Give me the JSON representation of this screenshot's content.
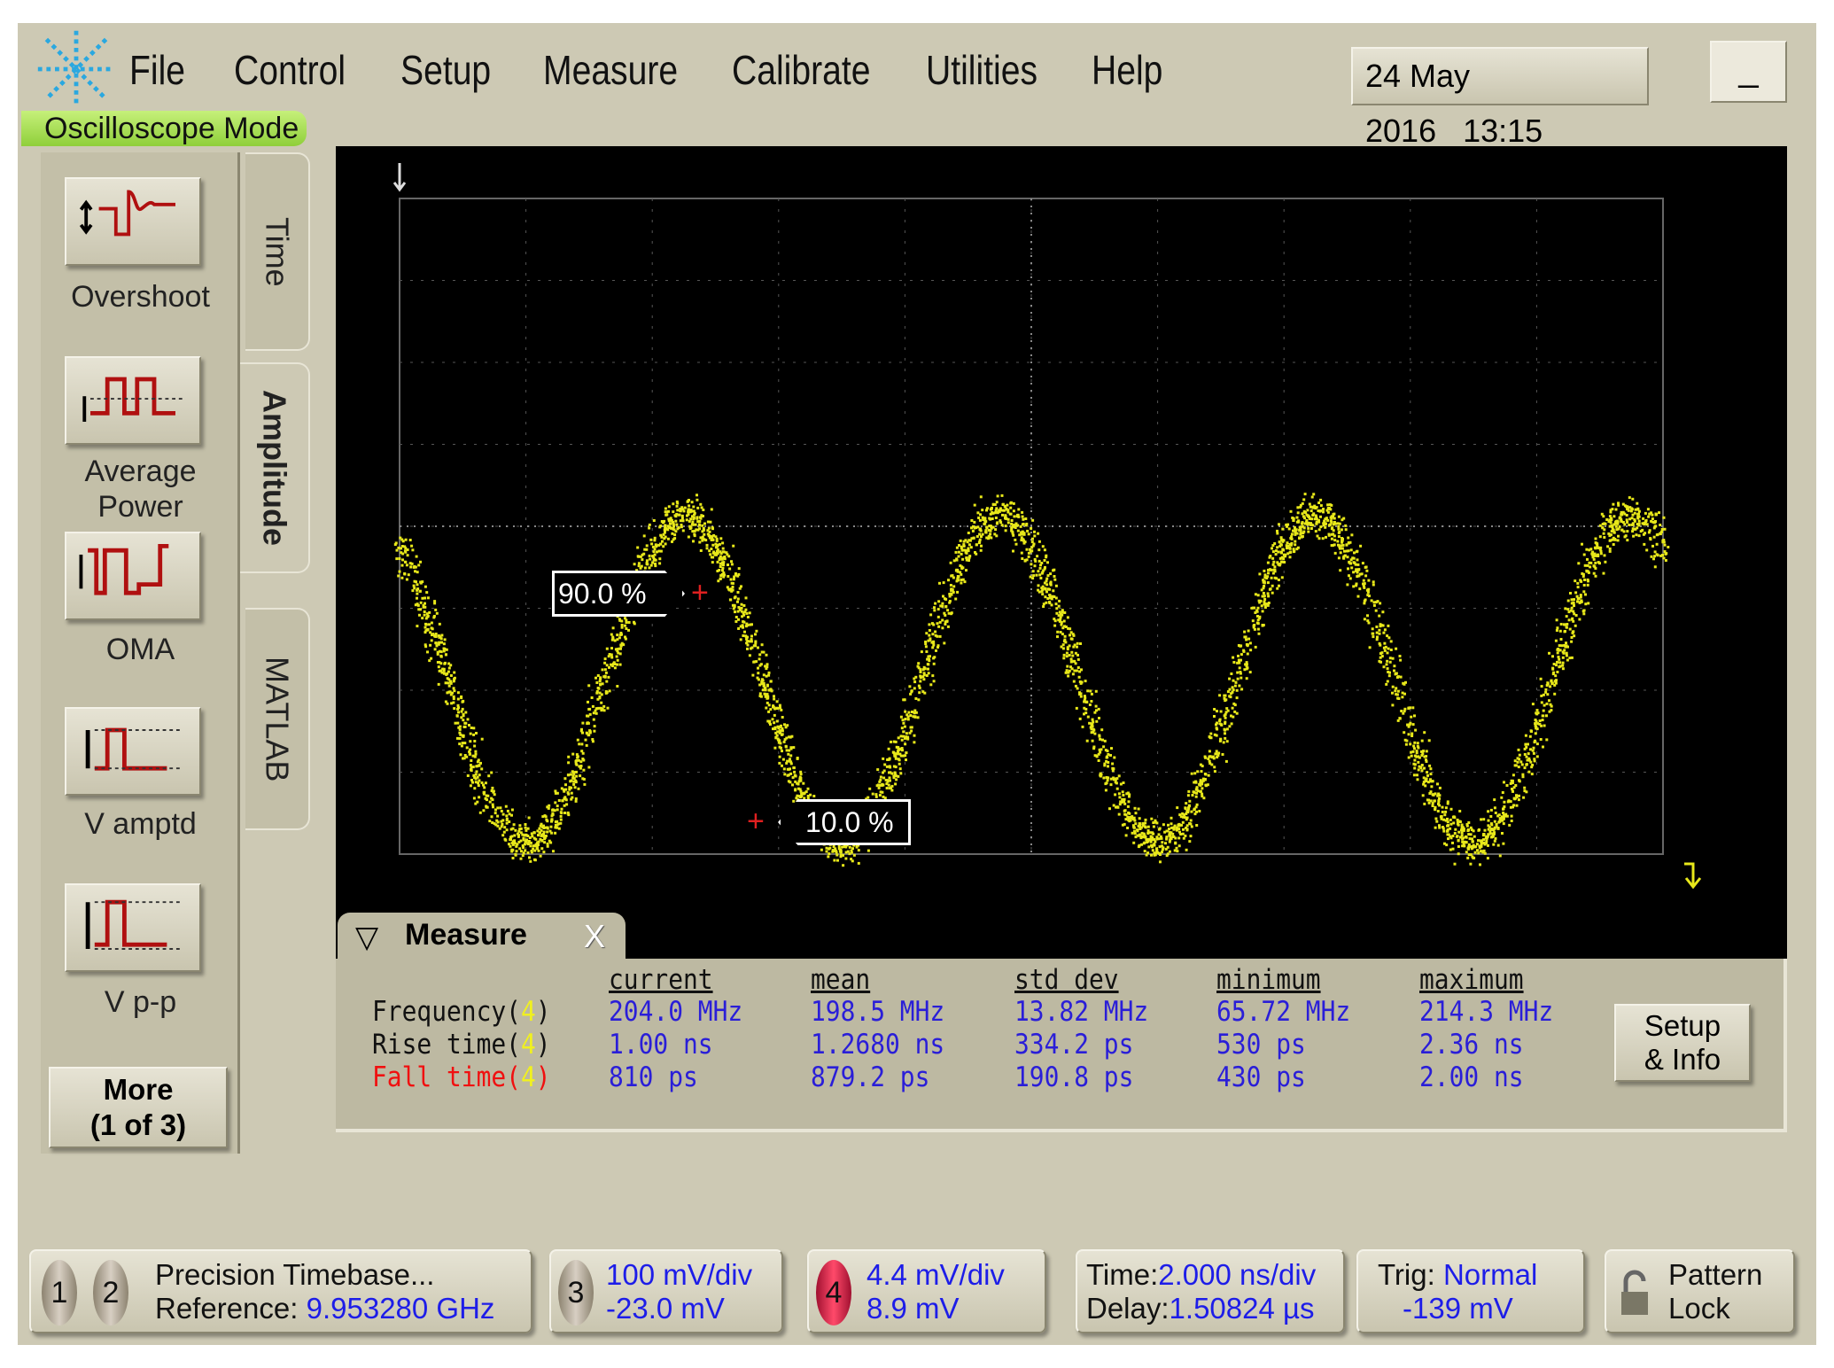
{
  "menu": {
    "items": [
      "File",
      "Control",
      "Setup",
      "Measure",
      "Calibrate",
      "Utilities",
      "Help"
    ],
    "date": "24 May 2016",
    "time": "13:15",
    "minimize_label": "_"
  },
  "mode": "Oscilloscope Mode",
  "sidebar": {
    "buttons": [
      {
        "label": "Overshoot"
      },
      {
        "label": "Average",
        "label2": "Power"
      },
      {
        "label": "OMA"
      },
      {
        "label": "V amptd"
      },
      {
        "label": "V p-p"
      }
    ],
    "more_line1": "More",
    "more_line2": "(1 of 3)"
  },
  "tabs": [
    "Time",
    "Amplitude",
    "MATLAB"
  ],
  "screen": {
    "label_90": "90.0 %",
    "label_10": "10.0 %",
    "trace_color": "#e8e81a"
  },
  "measure": {
    "title": "Measure",
    "close": "X",
    "headers": [
      "current",
      "mean",
      "std dev",
      "minimum",
      "maximum"
    ],
    "rows": [
      {
        "name": "Frequency(",
        "ch": "4",
        "close": ")",
        "values": [
          "204.0 MHz",
          "198.5 MHz",
          "13.82 MHz",
          "65.72 MHz",
          "214.3 MHz"
        ]
      },
      {
        "name": "Rise time(",
        "ch": "4",
        "close": ")",
        "values": [
          "1.00 ns",
          "1.2680 ns",
          "334.2 ps",
          "530 ps",
          "2.36 ns"
        ]
      },
      {
        "name": "Fall time(",
        "ch": "4",
        "close": ")",
        "values": [
          "810 ps",
          "879.2 ps",
          "190.8 ps",
          "430 ps",
          "2.00 ns"
        ]
      }
    ],
    "setup_line1": "Setup",
    "setup_line2": "& Info"
  },
  "bottom": {
    "ch1": "1",
    "ch2": "2",
    "timebase_line1": "Precision Timebase...",
    "reference_label": "Reference:",
    "reference_value": "9.953280 GHz",
    "ch3": "3",
    "ch3_scale": "100 mV/div",
    "ch3_offset": "-23.0 mV",
    "ch4": "4",
    "ch4_scale": "4.4 mV/div",
    "ch4_offset": "8.9 mV",
    "time_label": "Time:",
    "time_value": "2.000 ns/div",
    "delay_label": "Delay:",
    "delay_value": "1.50824 µs",
    "trig_label": "Trig:",
    "trig_value": "Normal",
    "trig_level": "-139 mV",
    "pattern_line1": "Pattern",
    "pattern_line2": "Lock"
  }
}
